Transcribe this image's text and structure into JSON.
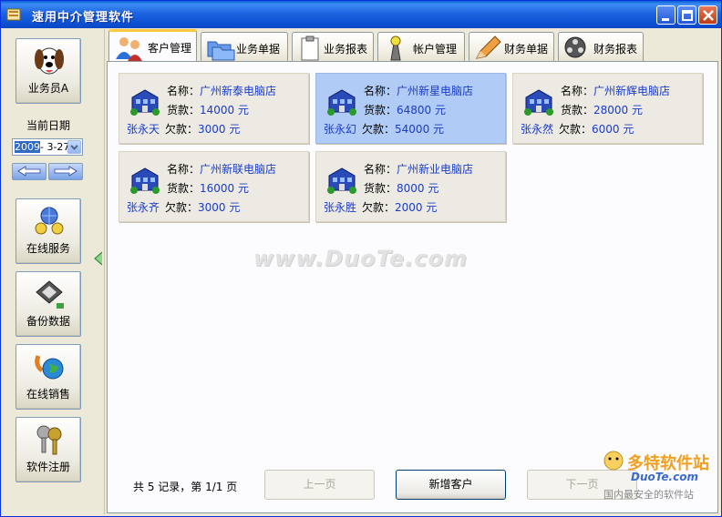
{
  "window": {
    "title": "速用中介管理软件"
  },
  "sidebar": {
    "user_button": "业务员A",
    "date_label": "当前日期",
    "date_year": "2009",
    "date_rest": "- 3-27",
    "buttons": [
      "在线服务",
      "备份数据",
      "在线销售",
      "软件注册"
    ]
  },
  "tabs": [
    {
      "label": "客户管理",
      "active": true
    },
    {
      "label": "业务单据",
      "active": false
    },
    {
      "label": "业务报表",
      "active": false
    },
    {
      "label": "帐户管理",
      "active": false
    },
    {
      "label": "财务单据",
      "active": false
    },
    {
      "label": "财务报表",
      "active": false
    }
  ],
  "labels": {
    "name": "名称：",
    "goods": "货款：",
    "owed": "欠款：",
    "unit": "元"
  },
  "customers": [
    {
      "name": "广州新泰电脑店",
      "goods": "14000",
      "person": "张永天",
      "owed": "3000",
      "selected": false
    },
    {
      "name": "广州新星电脑店",
      "goods": "64800",
      "person": "张永幻",
      "owed": "54000",
      "selected": true
    },
    {
      "name": "广州新辉电脑店",
      "goods": "28000",
      "person": "张永然",
      "owed": "6000",
      "selected": false
    },
    {
      "name": "广州新联电脑店",
      "goods": "16000",
      "person": "张永齐",
      "owed": "3000",
      "selected": false
    },
    {
      "name": "广州新业电脑店",
      "goods": "8000",
      "person": "张永胜",
      "owed": "2000",
      "selected": false
    }
  ],
  "watermark": "www.DuoTe.com",
  "footer": {
    "record_info": "共 5 记录，第 1/1 页",
    "prev": "上一页",
    "add": "新增客户",
    "next": "下一页"
  },
  "corner_logo": {
    "line1": "多特软件站",
    "line2": "DuoTe.com",
    "line3": "国内最安全的软件站"
  },
  "colors": {
    "title_bar": "#0a5fd8",
    "selected_card": "#b0cbf5",
    "link_text": "#1a3cc8",
    "active_tab_accent": "#ffc83c"
  }
}
